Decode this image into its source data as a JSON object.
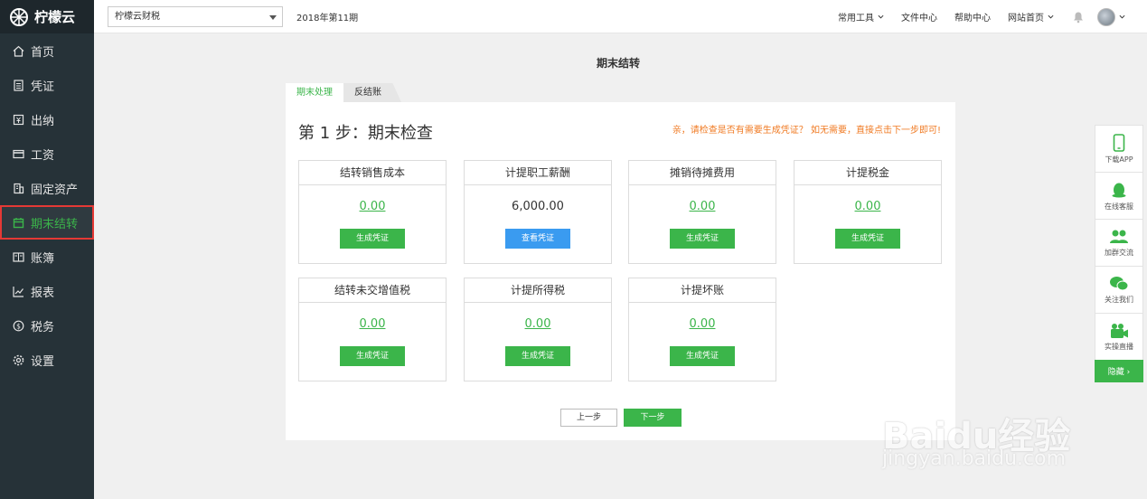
{
  "app": {
    "name": "柠檬云"
  },
  "sidebar": {
    "items": [
      {
        "label": "首页",
        "icon": "home-icon"
      },
      {
        "label": "凭证",
        "icon": "voucher-icon"
      },
      {
        "label": "出纳",
        "icon": "cashier-icon"
      },
      {
        "label": "工资",
        "icon": "salary-icon"
      },
      {
        "label": "固定资产",
        "icon": "building-icon"
      },
      {
        "label": "期末结转",
        "icon": "calendar-icon",
        "active": true
      },
      {
        "label": "账簿",
        "icon": "book-icon"
      },
      {
        "label": "报表",
        "icon": "chart-icon"
      },
      {
        "label": "税务",
        "icon": "tax-icon"
      },
      {
        "label": "设置",
        "icon": "gear-icon"
      }
    ]
  },
  "topbar": {
    "company": "柠檬云财税",
    "period": "2018年第11期",
    "links": {
      "tools": "常用工具",
      "files": "文件中心",
      "help": "帮助中心",
      "home": "网站首页"
    }
  },
  "page": {
    "title": "期末结转",
    "tabs": {
      "active": "期末处理",
      "inactive": "反结账"
    },
    "step_title": "第 1 步：期末检查",
    "hint": "亲，请检查是否有需要生成凭证？ 如无需要，直接点击下一步即可!",
    "cards": [
      {
        "title": "结转销售成本",
        "value": "0.00",
        "button": "生成凭证"
      },
      {
        "title": "计提职工薪酬",
        "value": "6,000.00",
        "button": "查看凭证"
      },
      {
        "title": "摊销待摊费用",
        "value": "0.00",
        "button": "生成凭证"
      },
      {
        "title": "计提税金",
        "value": "0.00",
        "button": "生成凭证"
      },
      {
        "title": "结转未交增值税",
        "value": "0.00",
        "button": "生成凭证"
      },
      {
        "title": "计提所得税",
        "value": "0.00",
        "button": "生成凭证"
      },
      {
        "title": "计提坏账",
        "value": "0.00",
        "button": "生成凭证"
      }
    ],
    "prev_label": "上一步",
    "next_label": "下一步"
  },
  "float_bar": {
    "download": "下载APP",
    "service": "在线客服",
    "group": "加群交流",
    "follow": "关注我们",
    "live": "实操直播",
    "hide": "隐藏 ›"
  },
  "watermark": {
    "brand": "Baidu经验",
    "url": "jingyan.baidu.com"
  },
  "colors": {
    "accent": "#3bb54a",
    "sidebar": "#263238",
    "blue_button": "#3a9bf0",
    "hint": "#f07b24",
    "active_outline": "#e53935"
  }
}
